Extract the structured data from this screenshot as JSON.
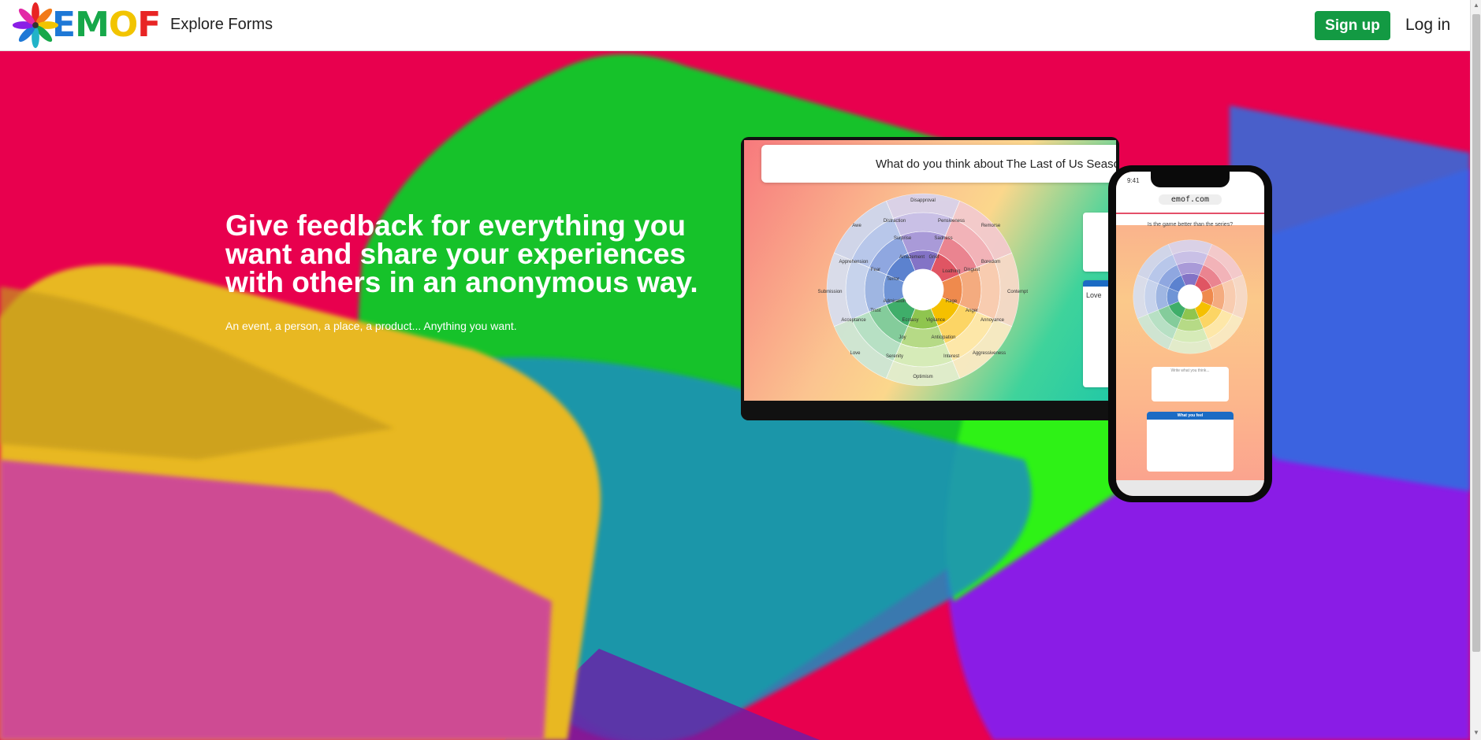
{
  "header": {
    "logo_text": [
      "E",
      "M",
      "O",
      "F"
    ],
    "nav_explore": "Explore Forms",
    "signup_label": "Sign up",
    "login_label": "Log in"
  },
  "hero": {
    "title": "Give feedback for everything you want and share your experiences with others in an anonymous way.",
    "subtitle": "An event, a person, a place, a product... Anything you want."
  },
  "tablet": {
    "question": "What do you think about The Last of Us Season",
    "card_label": "Love",
    "wheel_labels": [
      "Disapproval",
      "Awe",
      "Distraction",
      "Pensiveness",
      "Remorse",
      "Surprise",
      "Sadness",
      "Apprehension",
      "Amazement",
      "Grief",
      "Loathing",
      "Boredom",
      "Fear",
      "Disgust",
      "Terror",
      "Submission",
      "Contempt",
      "Admiration",
      "Rage",
      "Trust",
      "Anger",
      "Ecstasy",
      "Vigilance",
      "Acceptance",
      "Annoyance",
      "Joy",
      "Anticipation",
      "Serenity",
      "Interest",
      "Love",
      "Aggressiveness",
      "Optimism"
    ]
  },
  "phone": {
    "time": "9:41",
    "url": "emof.com",
    "question": "Is the game better than the series?",
    "textbox_placeholder": "Write what you think...",
    "card_title": "What you feel"
  },
  "colors": {
    "signup": "#139a43",
    "hero_red": "#e8004e",
    "green": "#12c22a",
    "yellow": "#e8b820",
    "purple": "#8a1ee6",
    "blue": "#1e78d6"
  }
}
